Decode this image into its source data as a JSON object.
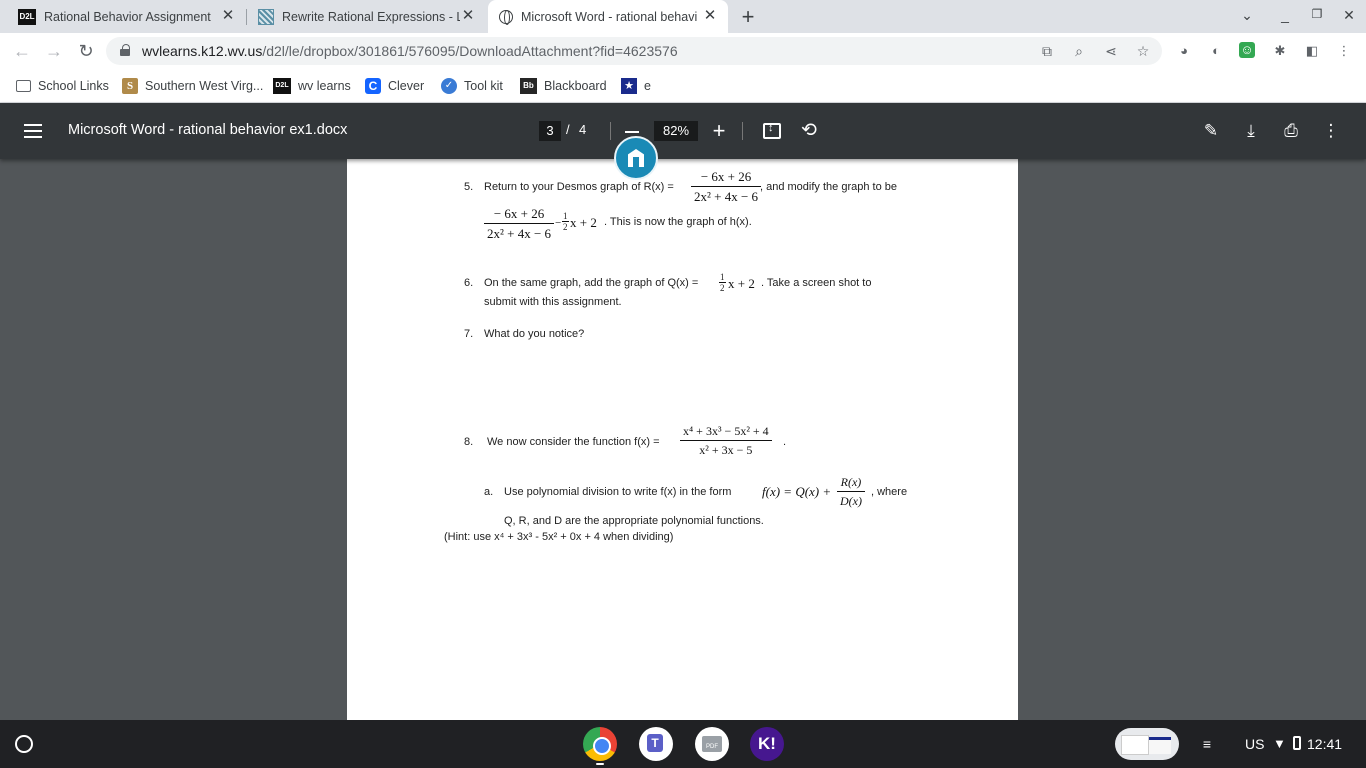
{
  "tabs": [
    {
      "label": "Rational Behavior Assignment - ",
      "favicon": "d2l-icon",
      "active": false
    },
    {
      "label": "Rewrite Rational Expressions - Lo",
      "favicon": "striped-icon",
      "active": false
    },
    {
      "label": "Microsoft Word - rational behavi",
      "favicon": "globe-icon",
      "active": true
    }
  ],
  "address": {
    "host": "wvlearns.k12.wv.us",
    "path": "/d2l/le/dropbox/301861/576095/DownloadAttachment?fid=4623576"
  },
  "bookmarks": [
    {
      "label": "School Links",
      "icon": "folder-icon",
      "glyph": ""
    },
    {
      "label": "Southern West Virg...",
      "icon": "southern-wv-icon",
      "glyph": "S"
    },
    {
      "label": "wv learns",
      "icon": "d2l-icon",
      "glyph": "D2L"
    },
    {
      "label": "Clever",
      "icon": "clever-icon",
      "glyph": "C"
    },
    {
      "label": "Tool kit",
      "icon": "toolkit-icon",
      "glyph": "✓"
    },
    {
      "label": "Blackboard",
      "icon": "blackboard-icon",
      "glyph": "Bb"
    },
    {
      "label": "e",
      "icon": "star-badge-icon",
      "glyph": "★"
    }
  ],
  "pdf": {
    "title": "Microsoft Word - rational behavior ex1.docx",
    "page_current": "3",
    "page_sep": "/",
    "page_total": "4",
    "zoom": "82%"
  },
  "doc": {
    "q5_num": "5.",
    "q5_text_a": "Return to your Desmos graph of R(x) = ",
    "q5_text_b": ", and modify the graph to be",
    "r_num": "− 6x + 26",
    "r_den": "2x² + 4x − 6",
    "h_num": "− 6x + 26",
    "h_den": "2x² + 4x − 6",
    "h_minus": "−",
    "half_num": "1",
    "half_den": "2",
    "h_tail": "x + 2",
    "q5_text_c": ".  This is now the graph of h(x).",
    "q6_num": "6.",
    "q6_text_a": "On the same graph, add the graph of Q(x) = ",
    "q6_tail": "x + 2",
    "q6_text_b": ".  Take a screen shot to",
    "q6_line2": "submit with this assignment.",
    "q7_num": "7.",
    "q7_text": "What do you notice?",
    "q8_num": "8.",
    "q8_text": "We now consider the function f(x) = ",
    "f_num": "x⁴ + 3x³ − 5x² + 4",
    "f_den": "x² + 3x − 5",
    "q8_dot": ".",
    "qa_label": "a.",
    "qa_text_a": "Use polynomial division to write f(x) in the form ",
    "qa_form": "f(x) = Q(x) +",
    "qa_frac_num": "R(x)",
    "qa_frac_den": "D(x)",
    "qa_text_b": ", where",
    "qa_line2": "Q, R, and D are the appropriate polynomial functions.",
    "hint": "(Hint:  use x⁴ + 3x³ - 5x² + 0x + 4 when dividing)"
  },
  "tray": {
    "locale": "US",
    "time": "12:41"
  }
}
